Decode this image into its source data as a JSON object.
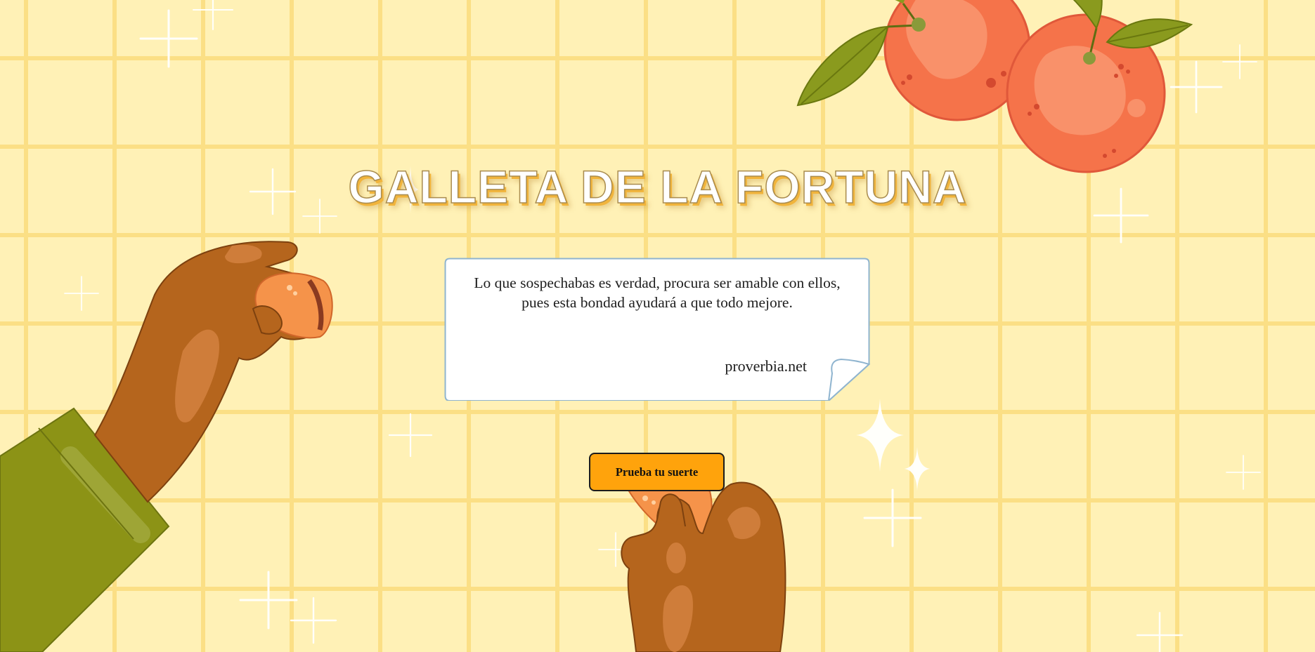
{
  "page": {
    "title": "GALLETA DE LA FORTUNA"
  },
  "fortune": {
    "message": "Lo que sospechabas es verdad, procura ser amable con ellos, pues esta bondad ayudará a que todo mejore.",
    "source": "proverbia.net"
  },
  "actions": {
    "try_luck_label": "Prueba tu suerte"
  },
  "icons": {
    "background": "yellow-grid-pattern",
    "decor": [
      "oranges-illustration",
      "left-hand-holding-cookie",
      "bottom-hand-holding-cookie",
      "sparkle-icon"
    ]
  },
  "colors": {
    "background": "#fff1b6",
    "grid": "#fbdf85",
    "title_shadow": "#f1b43c",
    "button": "#ffa30c",
    "orange": "#f5734a",
    "leaf": "#8a9a1e",
    "skin": "#b5651d",
    "sleeve": "#8c9316"
  }
}
